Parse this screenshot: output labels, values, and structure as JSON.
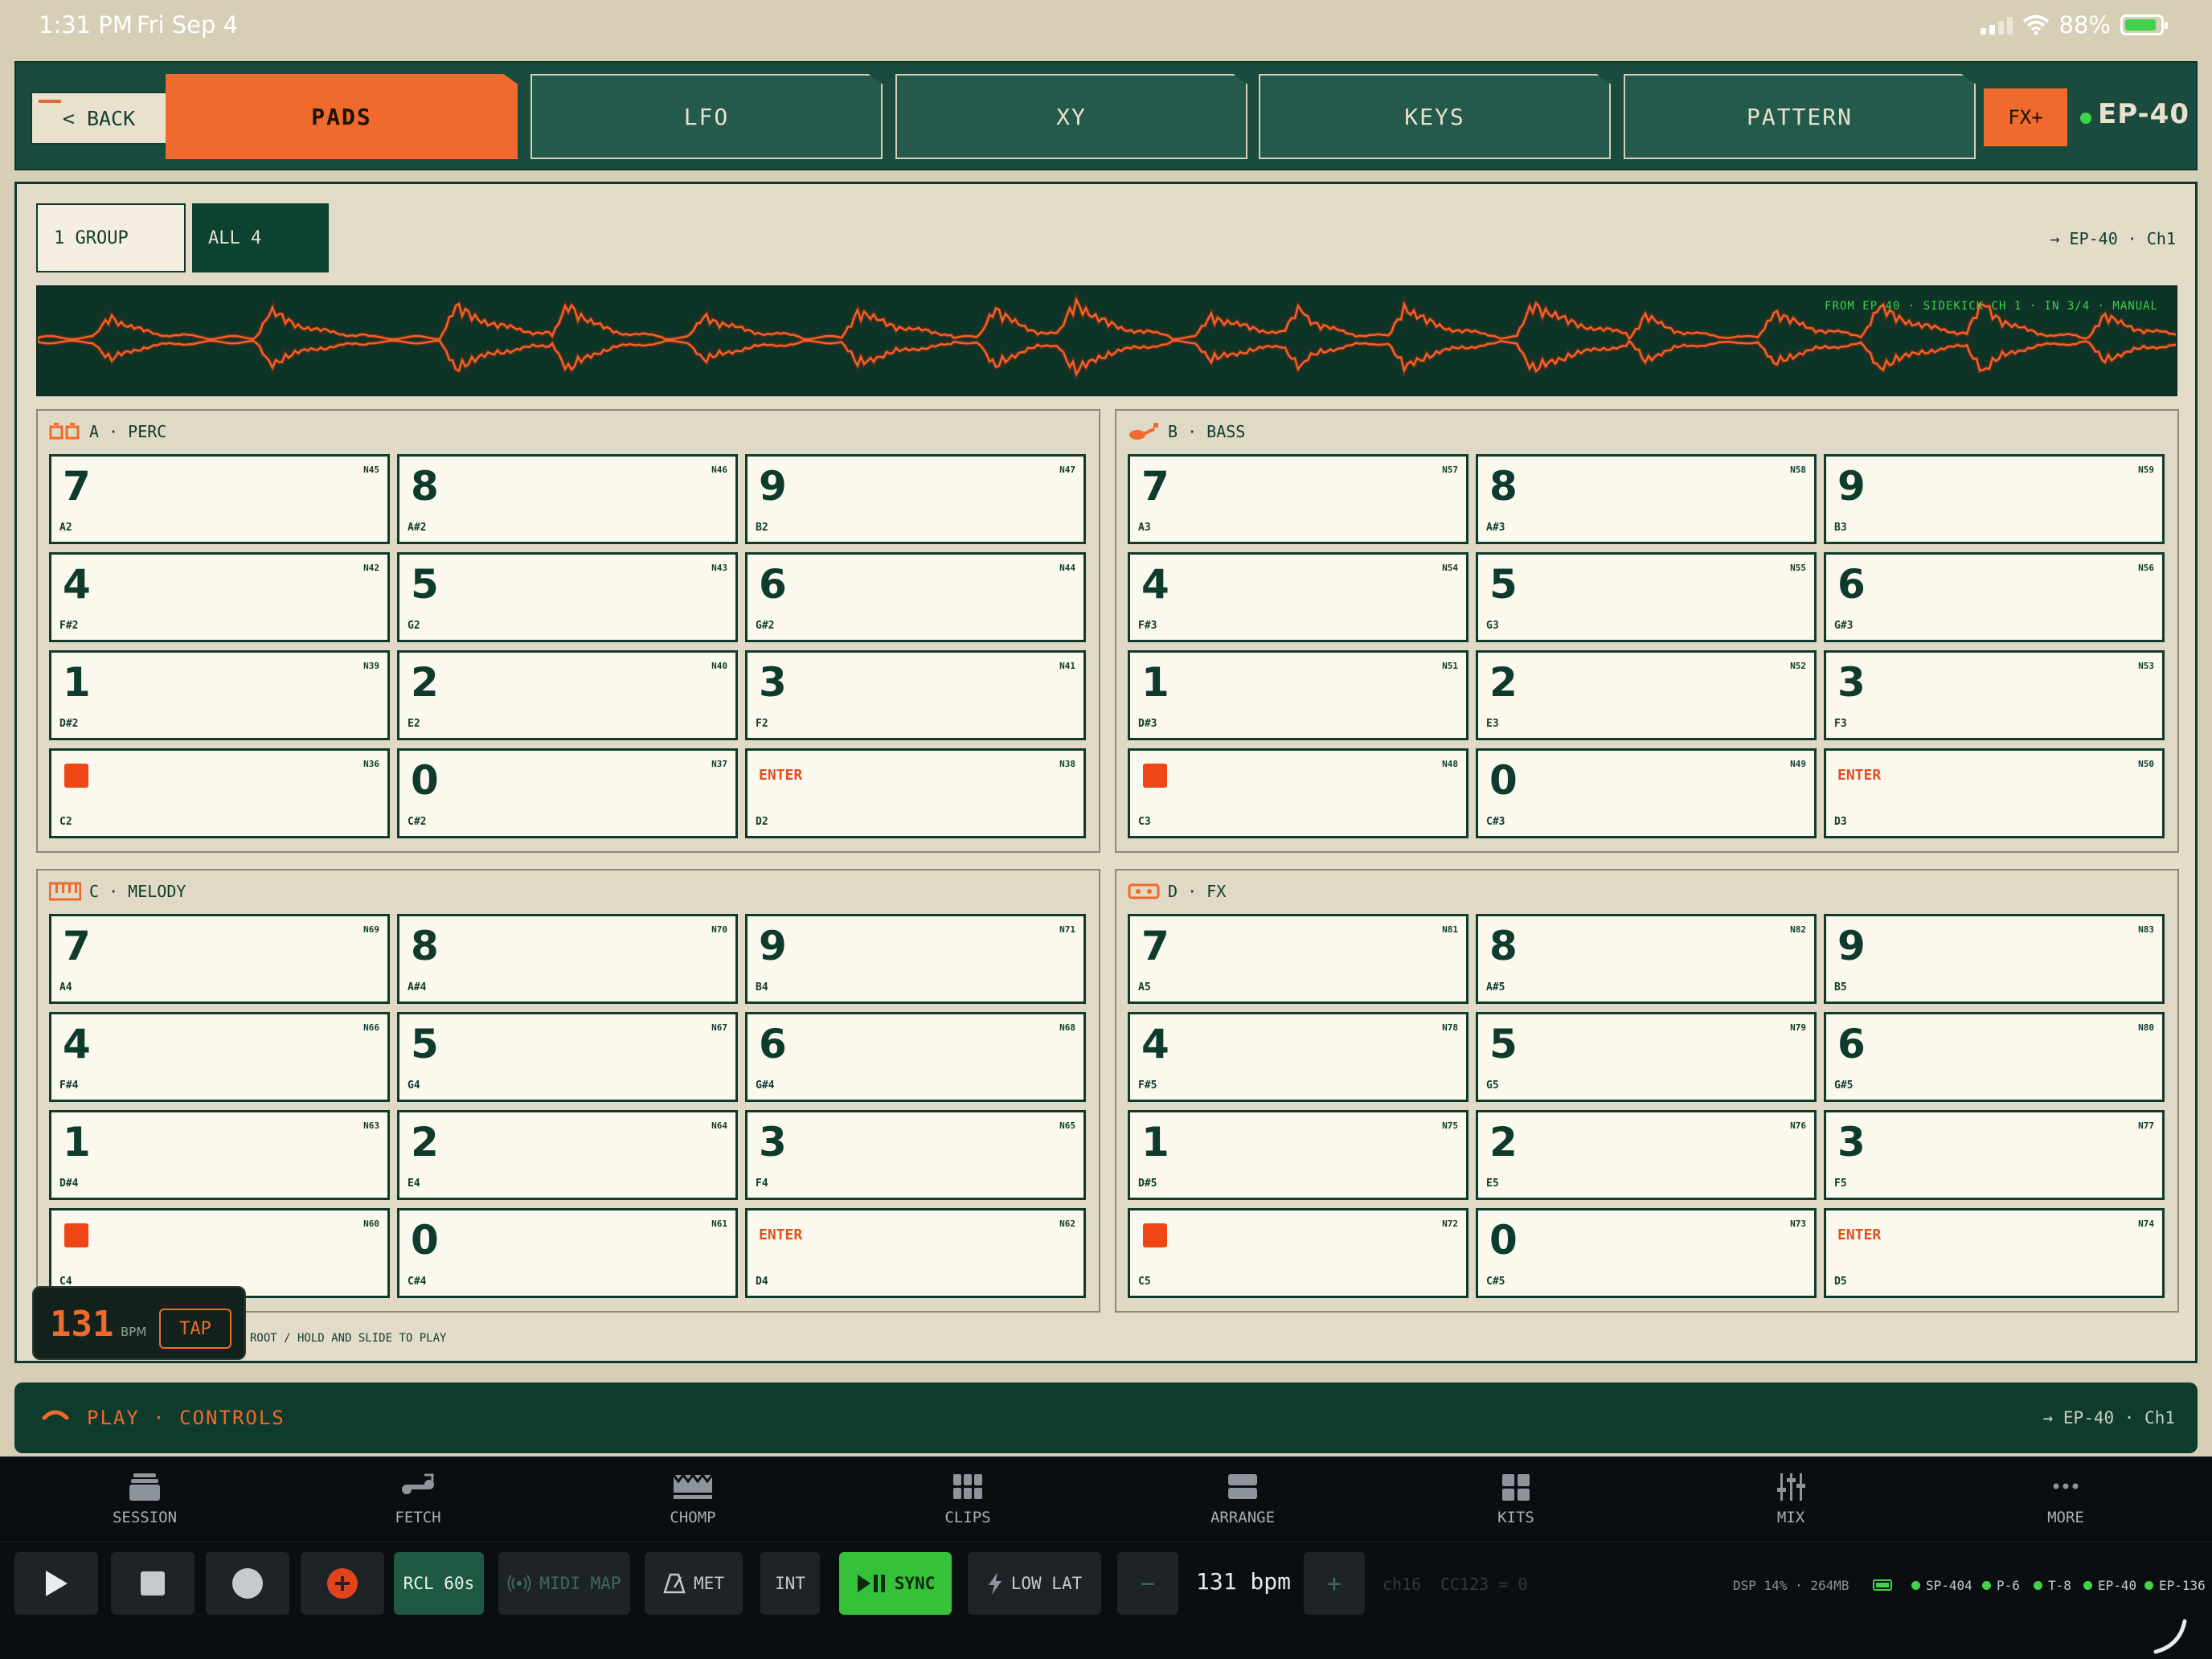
{
  "status": {
    "time": "1:31 PM",
    "date": "Fri Sep 4",
    "battery": "88%"
  },
  "topnav": {
    "back_label": "< BACK",
    "tabs": [
      {
        "label": "PADS",
        "active": true
      },
      {
        "label": "LFO",
        "active": false
      },
      {
        "label": "XY",
        "active": false
      },
      {
        "label": "KEYS",
        "active": false
      },
      {
        "label": "PATTERN",
        "active": false
      }
    ],
    "fx_label": "FX+",
    "device": "EP-40"
  },
  "main": {
    "group_mode": {
      "one_group": "1 GROUP",
      "all": "ALL 4"
    },
    "route": "→ EP-40 · Ch1",
    "waveform_caption": "FROM EP-40 · SIDEKICK CH 1 · IN 3/4 · MANUAL",
    "hint": "ROOT / HOLD AND SLIDE TO PLAY"
  },
  "groups": [
    {
      "title": "A · PERC",
      "pads": [
        {
          "label": "7",
          "midi": "N45",
          "note": "A2"
        },
        {
          "label": "8",
          "midi": "N46",
          "note": "A#2"
        },
        {
          "label": "9",
          "midi": "N47",
          "note": "B2"
        },
        {
          "label": "4",
          "midi": "N42",
          "note": "F#2"
        },
        {
          "label": "5",
          "midi": "N43",
          "note": "G2"
        },
        {
          "label": "6",
          "midi": "N44",
          "note": "G#2"
        },
        {
          "label": "1",
          "midi": "N39",
          "note": "D#2"
        },
        {
          "label": "2",
          "midi": "N40",
          "note": "E2"
        },
        {
          "label": "3",
          "midi": "N41",
          "note": "F2"
        },
        {
          "label": "",
          "midi": "N36",
          "note": "C2",
          "kind": "stop"
        },
        {
          "label": "0",
          "midi": "N37",
          "note": "C#2"
        },
        {
          "label": "ENTER",
          "midi": "N38",
          "note": "D2",
          "kind": "enter"
        }
      ]
    },
    {
      "title": "B · BASS",
      "pads": [
        {
          "label": "7",
          "midi": "N57",
          "note": "A3"
        },
        {
          "label": "8",
          "midi": "N58",
          "note": "A#3"
        },
        {
          "label": "9",
          "midi": "N59",
          "note": "B3"
        },
        {
          "label": "4",
          "midi": "N54",
          "note": "F#3"
        },
        {
          "label": "5",
          "midi": "N55",
          "note": "G3"
        },
        {
          "label": "6",
          "midi": "N56",
          "note": "G#3"
        },
        {
          "label": "1",
          "midi": "N51",
          "note": "D#3"
        },
        {
          "label": "2",
          "midi": "N52",
          "note": "E3"
        },
        {
          "label": "3",
          "midi": "N53",
          "note": "F3"
        },
        {
          "label": "",
          "midi": "N48",
          "note": "C3",
          "kind": "stop"
        },
        {
          "label": "0",
          "midi": "N49",
          "note": "C#3"
        },
        {
          "label": "ENTER",
          "midi": "N50",
          "note": "D3",
          "kind": "enter"
        }
      ]
    },
    {
      "title": "C · MELODY",
      "pads": [
        {
          "label": "7",
          "midi": "N69",
          "note": "A4"
        },
        {
          "label": "8",
          "midi": "N70",
          "note": "A#4"
        },
        {
          "label": "9",
          "midi": "N71",
          "note": "B4"
        },
        {
          "label": "4",
          "midi": "N66",
          "note": "F#4"
        },
        {
          "label": "5",
          "midi": "N67",
          "note": "G4"
        },
        {
          "label": "6",
          "midi": "N68",
          "note": "G#4"
        },
        {
          "label": "1",
          "midi": "N63",
          "note": "D#4"
        },
        {
          "label": "2",
          "midi": "N64",
          "note": "E4"
        },
        {
          "label": "3",
          "midi": "N65",
          "note": "F4"
        },
        {
          "label": "",
          "midi": "N60",
          "note": "C4",
          "kind": "stop"
        },
        {
          "label": "0",
          "midi": "N61",
          "note": "C#4"
        },
        {
          "label": "ENTER",
          "midi": "N62",
          "note": "D4",
          "kind": "enter"
        }
      ]
    },
    {
      "title": "D · FX",
      "pads": [
        {
          "label": "7",
          "midi": "N81",
          "note": "A5"
        },
        {
          "label": "8",
          "midi": "N82",
          "note": "A#5"
        },
        {
          "label": "9",
          "midi": "N83",
          "note": "B5"
        },
        {
          "label": "4",
          "midi": "N78",
          "note": "F#5"
        },
        {
          "label": "5",
          "midi": "N79",
          "note": "G5"
        },
        {
          "label": "6",
          "midi": "N80",
          "note": "G#5"
        },
        {
          "label": "1",
          "midi": "N75",
          "note": "D#5"
        },
        {
          "label": "2",
          "midi": "N76",
          "note": "E5"
        },
        {
          "label": "3",
          "midi": "N77",
          "note": "F5"
        },
        {
          "label": "",
          "midi": "N72",
          "note": "C5",
          "kind": "stop"
        },
        {
          "label": "0",
          "midi": "N73",
          "note": "C#5"
        },
        {
          "label": "ENTER",
          "midi": "N74",
          "note": "D5",
          "kind": "enter"
        }
      ]
    }
  ],
  "bpm_widget": {
    "value": "131",
    "unit": "BPM",
    "tap": "TAP"
  },
  "playbar": {
    "title": "PLAY · CONTROLS",
    "route": "→ EP-40 · Ch1"
  },
  "bottomnav": [
    {
      "label": "SESSION",
      "icon": "session-icon"
    },
    {
      "label": "FETCH",
      "icon": "fetch-icon"
    },
    {
      "label": "CHOMP",
      "icon": "chomp-icon"
    },
    {
      "label": "CLIPS",
      "icon": "clips-icon"
    },
    {
      "label": "ARRANGE",
      "icon": "arrange-icon"
    },
    {
      "label": "KITS",
      "icon": "kits-icon"
    },
    {
      "label": "MIX",
      "icon": "mix-icon"
    },
    {
      "label": "MORE",
      "icon": "more-icon"
    }
  ],
  "transport": {
    "rcl": "RCL 60s",
    "midimap": "MIDI MAP",
    "met": "MET",
    "int": "INT",
    "sync": "SYNC",
    "lowlat": "LOW LAT",
    "minus": "−",
    "plus": "+",
    "bpm": "131 bpm",
    "channel": "ch16",
    "cc": "CC123 = 0",
    "stats": "DSP 14% · 264MB",
    "devices": [
      "SP-404",
      "P-6",
      "T-8",
      "EP-40",
      "EP-136"
    ]
  }
}
